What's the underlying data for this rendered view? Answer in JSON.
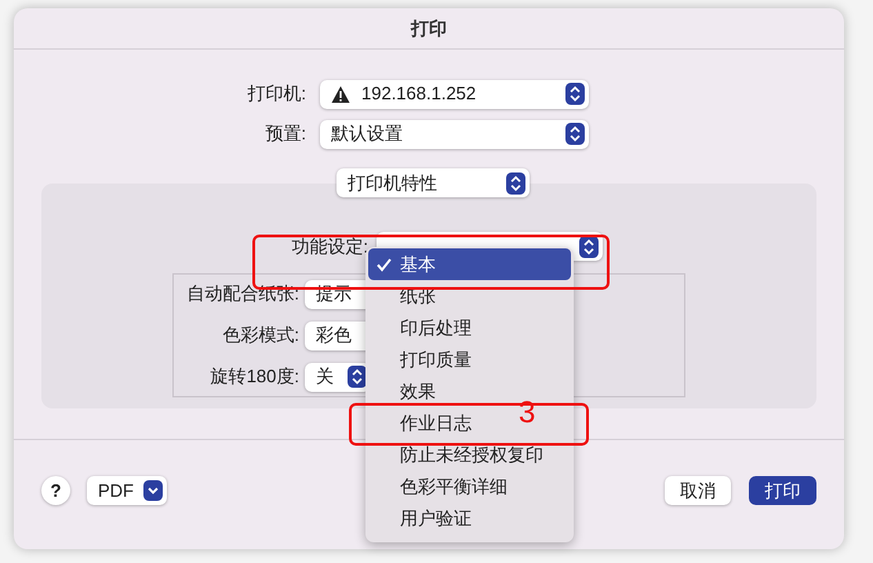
{
  "window": {
    "title": "打印"
  },
  "printer": {
    "label": "打印机:",
    "value": "192.168.1.252",
    "warning": true
  },
  "preset": {
    "label": "预置:",
    "value": "默认设置"
  },
  "section": {
    "value": "打印机特性"
  },
  "feature_set": {
    "label": "功能设定:"
  },
  "settings": [
    {
      "label": "自动配合纸张:",
      "value": "提示"
    },
    {
      "label": "色彩模式:",
      "value": "彩色"
    },
    {
      "label": "旋转180度:",
      "value": "关"
    }
  ],
  "menu": [
    {
      "label": "基本",
      "selected": true
    },
    {
      "label": "纸张",
      "selected": false
    },
    {
      "label": "印后处理",
      "selected": false
    },
    {
      "label": "打印质量",
      "selected": false
    },
    {
      "label": "效果",
      "selected": false
    },
    {
      "label": "作业日志",
      "selected": false
    },
    {
      "label": "防止未经授权复印",
      "selected": false
    },
    {
      "label": "色彩平衡详细",
      "selected": false
    },
    {
      "label": "用户验证",
      "selected": false
    }
  ],
  "annotations": [
    {
      "kind": "frame"
    },
    {
      "kind": "frame",
      "label": "3"
    }
  ],
  "footer": {
    "help": "?",
    "pdf": "PDF",
    "cancel": "取消",
    "print": "打印"
  }
}
